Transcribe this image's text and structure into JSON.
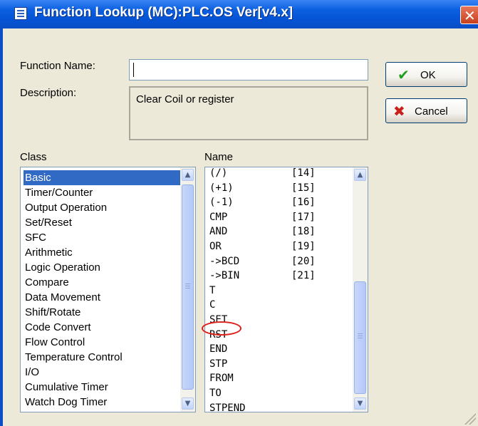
{
  "window": {
    "title": "Function Lookup (MC):PLC.OS Ver[v4.x]"
  },
  "form": {
    "function_name_label": "Function Name:",
    "function_name_value": "",
    "description_label": "Description:",
    "description_text": "Clear Coil or register"
  },
  "buttons": {
    "ok_label": "OK",
    "cancel_label": "Cancel"
  },
  "class_list": {
    "label": "Class",
    "selected": "Basic",
    "items": [
      "Basic",
      "Timer/Counter",
      "Output Operation",
      "Set/Reset",
      "SFC",
      "Arithmetic",
      "Logic Operation",
      "Compare",
      "Data Movement",
      "Shift/Rotate",
      "Code Convert",
      "Flow Control",
      "Temperature Control",
      "I/O",
      "Cumulative Timer",
      "Watch Dog Timer"
    ]
  },
  "name_list": {
    "label": "Name",
    "highlighted": "RST",
    "items": [
      {
        "name": "(/)",
        "code": "[14]"
      },
      {
        "name": "(+1)",
        "code": "[15]"
      },
      {
        "name": "(-1)",
        "code": "[16]"
      },
      {
        "name": "CMP",
        "code": "[17]"
      },
      {
        "name": "AND",
        "code": "[18]"
      },
      {
        "name": "OR",
        "code": "[19]"
      },
      {
        "name": "->BCD",
        "code": "[20]"
      },
      {
        "name": "->BIN",
        "code": "[21]"
      },
      {
        "name": "T",
        "code": ""
      },
      {
        "name": "C",
        "code": ""
      },
      {
        "name": "SET",
        "code": ""
      },
      {
        "name": "RST",
        "code": ""
      },
      {
        "name": "END",
        "code": ""
      },
      {
        "name": "STP",
        "code": ""
      },
      {
        "name": "FROM",
        "code": ""
      },
      {
        "name": "TO",
        "code": ""
      },
      {
        "name": "STPEND",
        "code": ""
      }
    ]
  },
  "colors": {
    "title_bar": "#0a5fe0",
    "selection": "#316ac5",
    "highlight_circle": "#e0201c",
    "ok_check": "#1f9e1f",
    "cancel_x": "#c8201a"
  },
  "icons": {
    "app": "function-lookup-icon",
    "close": "close-icon",
    "ok": "checkmark-icon",
    "cancel": "x-icon",
    "scroll_up": "chevron-up-icon",
    "scroll_down": "chevron-down-icon",
    "close_glyph": "✕",
    "ok_glyph": "✔",
    "cancel_glyph": "✖",
    "up_glyph": "▲",
    "down_glyph": "▼"
  }
}
